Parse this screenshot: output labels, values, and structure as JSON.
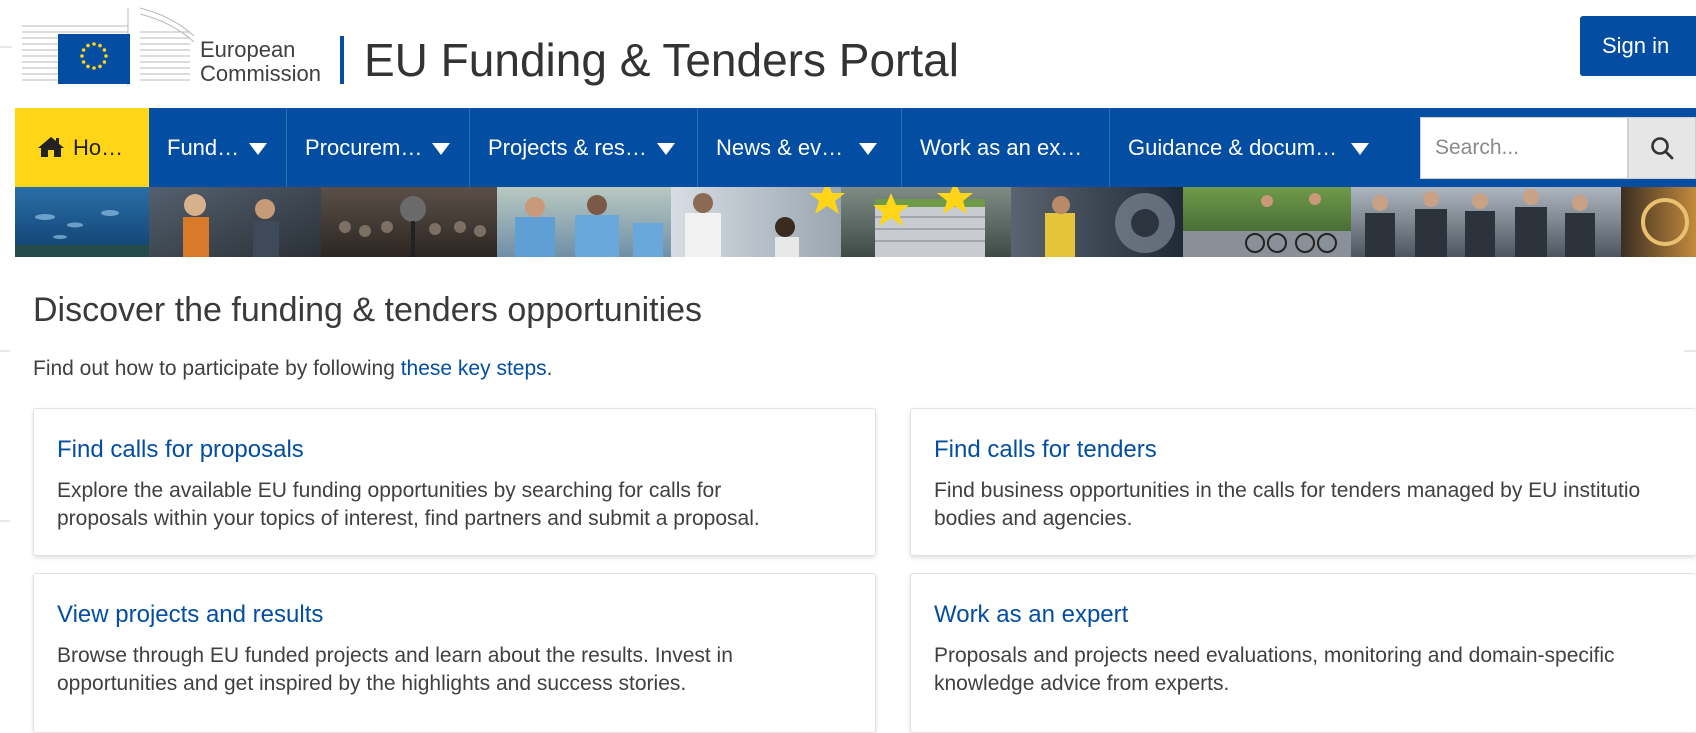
{
  "header": {
    "logo_line1": "European",
    "logo_line2": "Commission",
    "portal_title": "EU Funding & Tenders Portal",
    "signin_label": "Sign in"
  },
  "nav": {
    "items": [
      {
        "label": "Ho…",
        "icon": "home-icon",
        "has_dropdown": false
      },
      {
        "label": "Fund…",
        "has_dropdown": true
      },
      {
        "label": "Procurem…",
        "has_dropdown": true
      },
      {
        "label": "Projects & res…",
        "has_dropdown": true
      },
      {
        "label": "News & ev…",
        "has_dropdown": true
      },
      {
        "label": "Work as an ex…",
        "has_dropdown": false
      },
      {
        "label": "Guidance & docum…",
        "has_dropdown": true
      }
    ],
    "search_placeholder": "Search..."
  },
  "main": {
    "heading": "Discover the funding & tenders opportunities",
    "intro_prefix": "Find out how to participate by following ",
    "intro_link": "these key steps",
    "intro_suffix": ".",
    "cards": [
      {
        "title": "Find calls for proposals",
        "text": "Explore the available EU funding opportunities by searching for calls for\nproposals within your topics of interest, find partners and submit a proposal."
      },
      {
        "title": "Find calls for tenders",
        "text": "Find business opportunities in the calls for tenders managed by EU institutio\nbodies and agencies."
      },
      {
        "title": "View projects and results",
        "text": "Browse through EU funded projects and learn about the results. Invest in\nopportunities and get inspired by the highlights and success stories."
      },
      {
        "title": "Work as an expert",
        "text": "Proposals and projects need evaluations, monitoring and domain-specific\nknowledge advice from experts."
      }
    ]
  },
  "colors": {
    "brand_blue": "#034ea2",
    "home_yellow": "#ffd617"
  }
}
